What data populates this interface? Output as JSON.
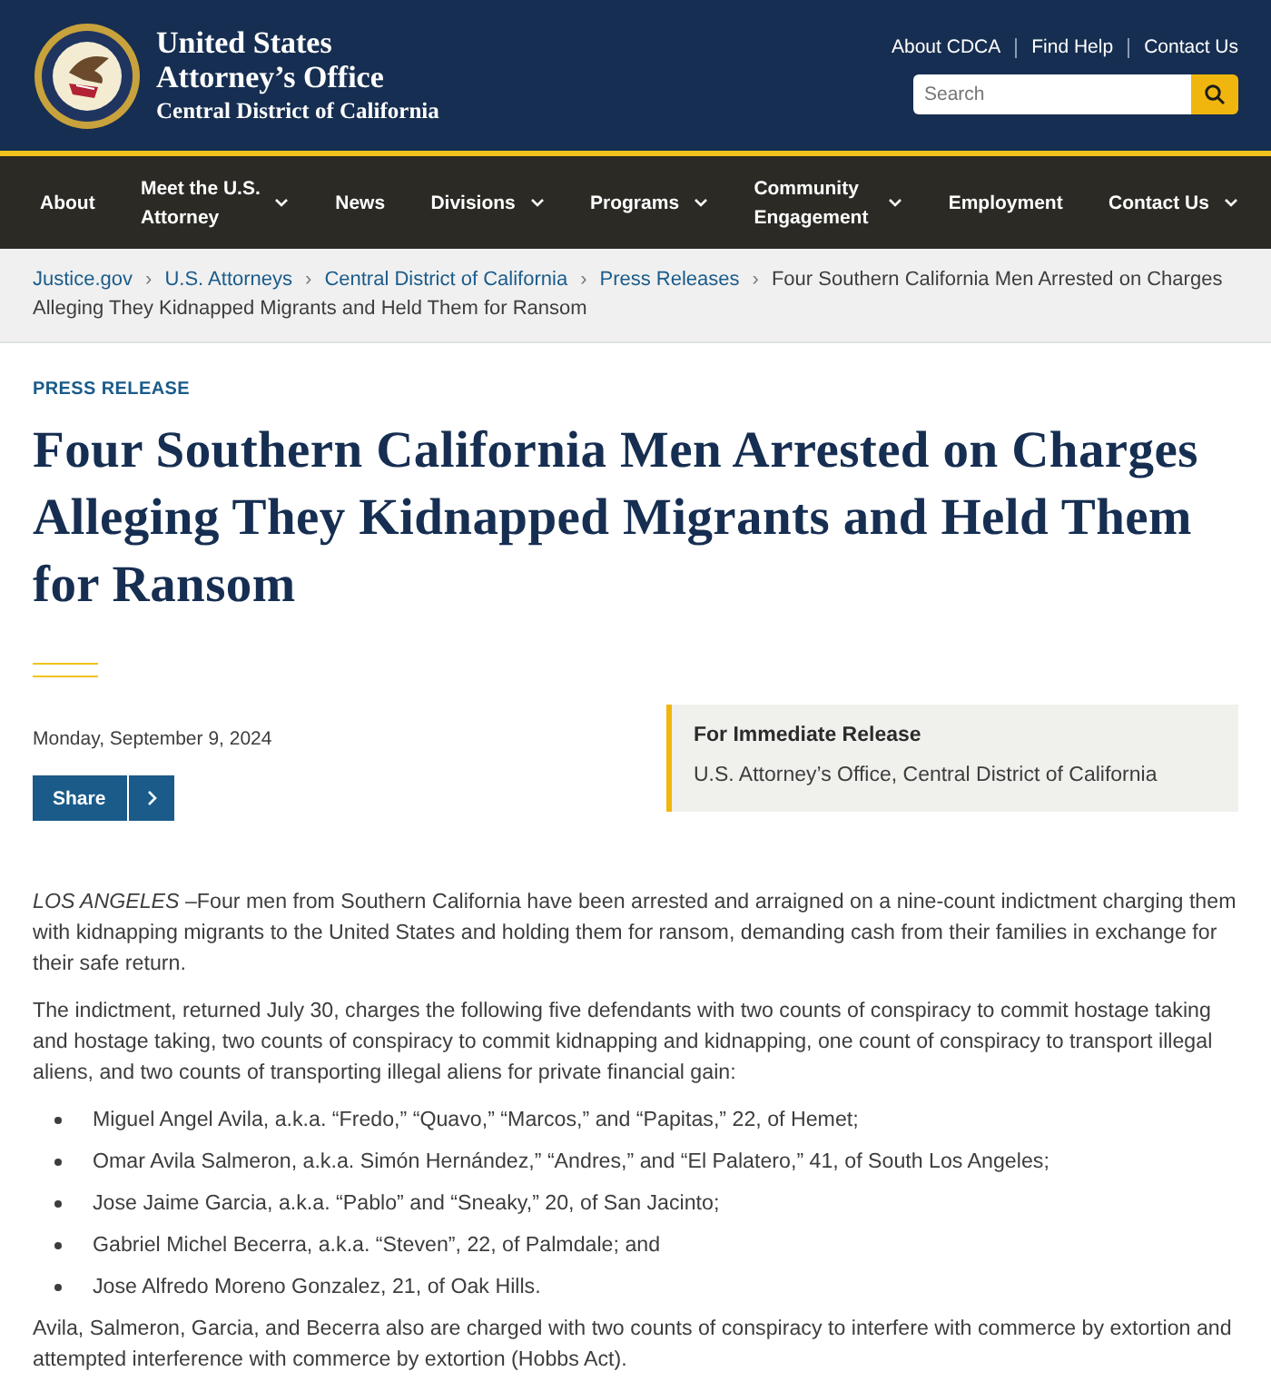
{
  "header": {
    "title_lines": [
      "United States",
      "Attorney’s Office"
    ],
    "subtitle": "Central District of California",
    "utility_links": [
      "About CDCA",
      "Find Help",
      "Contact Us"
    ],
    "search": {
      "placeholder": "Search"
    }
  },
  "nav": [
    {
      "label": "About",
      "has_menu": false
    },
    {
      "label": "Meet the U.S. Attorney",
      "has_menu": true
    },
    {
      "label": "News",
      "has_menu": false
    },
    {
      "label": "Divisions",
      "has_menu": true
    },
    {
      "label": "Programs",
      "has_menu": true
    },
    {
      "label": "Community Engagement",
      "has_menu": true
    },
    {
      "label": "Employment",
      "has_menu": false
    },
    {
      "label": "Contact Us",
      "has_menu": true
    }
  ],
  "breadcrumb": {
    "links": [
      "Justice.gov",
      "U.S. Attorneys",
      "Central District of California",
      "Press Releases"
    ],
    "separator": "›",
    "current_lines": [
      "Four Southern California Men Arrested on Charges",
      "Alleging They Kidnapped Migrants and Held Them for Ransom"
    ]
  },
  "article": {
    "eyebrow": "PRESS RELEASE",
    "title": "Four Southern California Men Arrested on Charges Alleging They Kidnapped Migrants and Held Them for Ransom",
    "date": "Monday, September 9, 2024",
    "share_button": "Share",
    "release_box": {
      "heading": "For Immediate Release",
      "source": "U.S. Attorney’s Office, Central District of California"
    },
    "paragraphs_before": [
      "*LOS ANGELES* –Four men from Southern California have been arrested and arraigned on a nine-count indictment charging them with kidnapping migrants to the United States and holding them for ransom, demanding cash from their families in exchange for their safe return.",
      "The indictment, returned July 30, charges the following five defendants with two counts of conspiracy to commit hostage taking and hostage taking, two counts of conspiracy to commit kidnapping and kidnapping, one count of conspiracy to transport illegal aliens, and two counts of transporting illegal aliens for private financial gain:"
    ],
    "defendants": [
      "Miguel Angel Avila, a.k.a. “Fredo,” “Quavo,” “Marcos,” and “Papitas,” 22, of Hemet;",
      "Omar Avila Salmeron, a.k.a. Simón Hernández,” “Andres,” and “El Palatero,” 41, of South Los Angeles;",
      "Jose Jaime Garcia, a.k.a. “Pablo” and “Sneaky,” 20, of San Jacinto;",
      "Gabriel Michel Becerra, a.k.a. “Steven”, 22, of Palmdale; and",
      "Jose Alfredo Moreno Gonzalez, 21, of Oak Hills."
    ],
    "paragraphs_after": [
      "Avila, Salmeron, Garcia, and Becerra also are charged with two counts of conspiracy to interfere with commerce by extortion and attempted interference with commerce by extortion (Hobbs Act)."
    ]
  }
}
